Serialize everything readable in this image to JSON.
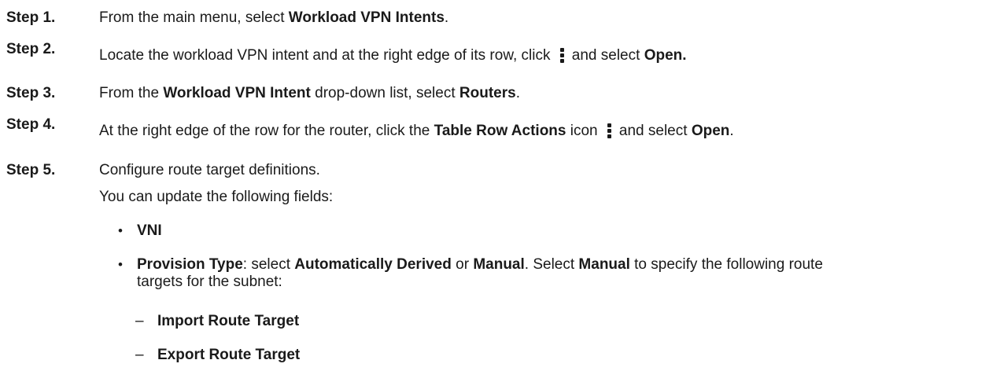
{
  "steps": [
    {
      "label": "Step 1.",
      "parts": [
        {
          "text": "From the main menu, select "
        },
        {
          "text": "Workload VPN Intents",
          "bold": true
        },
        {
          "text": "."
        }
      ]
    },
    {
      "label": "Step 2.",
      "parts": [
        {
          "text": "Locate the workload VPN intent and at the right edge of its row, click "
        },
        {
          "icon": "kebab-menu-icon"
        },
        {
          "text": "and select "
        },
        {
          "text": "Open.",
          "bold": true
        }
      ]
    },
    {
      "label": "Step 3.",
      "parts": [
        {
          "text": "From the "
        },
        {
          "text": "Workload VPN Intent",
          "bold": true
        },
        {
          "text": " drop-down list, select "
        },
        {
          "text": "Routers",
          "bold": true
        },
        {
          "text": "."
        }
      ]
    },
    {
      "label": "Step 4.",
      "parts": [
        {
          "text": "At the right edge of the row for the router, click the "
        },
        {
          "text": "Table Row Actions",
          "bold": true
        },
        {
          "text": " icon "
        },
        {
          "icon": "kebab-menu-icon"
        },
        {
          "text": "and select "
        },
        {
          "text": "Open",
          "bold": true
        },
        {
          "text": "."
        }
      ]
    },
    {
      "label": "Step 5.",
      "parts": [
        {
          "text": "Configure route target definitions."
        }
      ]
    }
  ],
  "step5_intro": "You can update the following fields:",
  "bullets": [
    {
      "mark": "•",
      "parts": [
        {
          "text": "VNI",
          "bold": true
        }
      ]
    },
    {
      "mark": "•",
      "parts": [
        {
          "text": "Provision Type",
          "bold": true
        },
        {
          "text": ": select "
        },
        {
          "text": "Automatically Derived",
          "bold": true
        },
        {
          "text": " or "
        },
        {
          "text": "Manual",
          "bold": true
        },
        {
          "text": ". Select "
        },
        {
          "text": "Manual",
          "bold": true
        },
        {
          "text": " to specify the following route targets for the subnet:"
        }
      ]
    }
  ],
  "sub_bullets": [
    {
      "mark": "–",
      "text": "Import Route Target"
    },
    {
      "mark": "–",
      "text": "Export Route Target"
    }
  ]
}
